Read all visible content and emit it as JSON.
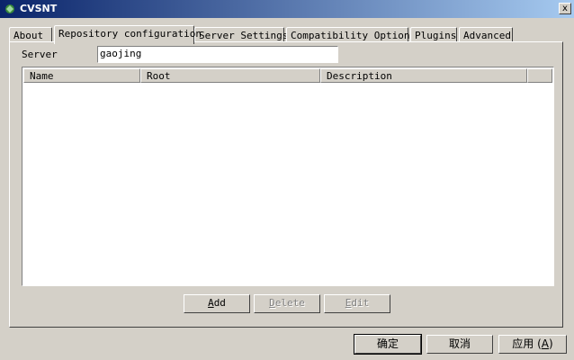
{
  "window": {
    "title": "CVSNT",
    "close_label": "x"
  },
  "tabs": [
    {
      "label": "About"
    },
    {
      "label": "Repository configuration",
      "active": true
    },
    {
      "label": "Server Settings"
    },
    {
      "label": "Compatibility Options"
    },
    {
      "label": "Plugins"
    },
    {
      "label": "Advanced"
    }
  ],
  "server": {
    "label": "Server",
    "value": "gaojing"
  },
  "repository_list": {
    "columns": [
      "Name",
      "Root",
      "Description"
    ],
    "rows": []
  },
  "list_buttons": {
    "add": {
      "mnemonic": "A",
      "rest": "dd"
    },
    "delete": {
      "mnemonic": "D",
      "rest": "elete"
    },
    "edit": {
      "mnemonic": "E",
      "rest": "dit"
    }
  },
  "dialog_buttons": {
    "ok": "确定",
    "cancel": "取消",
    "apply": {
      "text": "应用",
      "open": " (",
      "mnemonic": "A",
      "close": ")"
    }
  }
}
